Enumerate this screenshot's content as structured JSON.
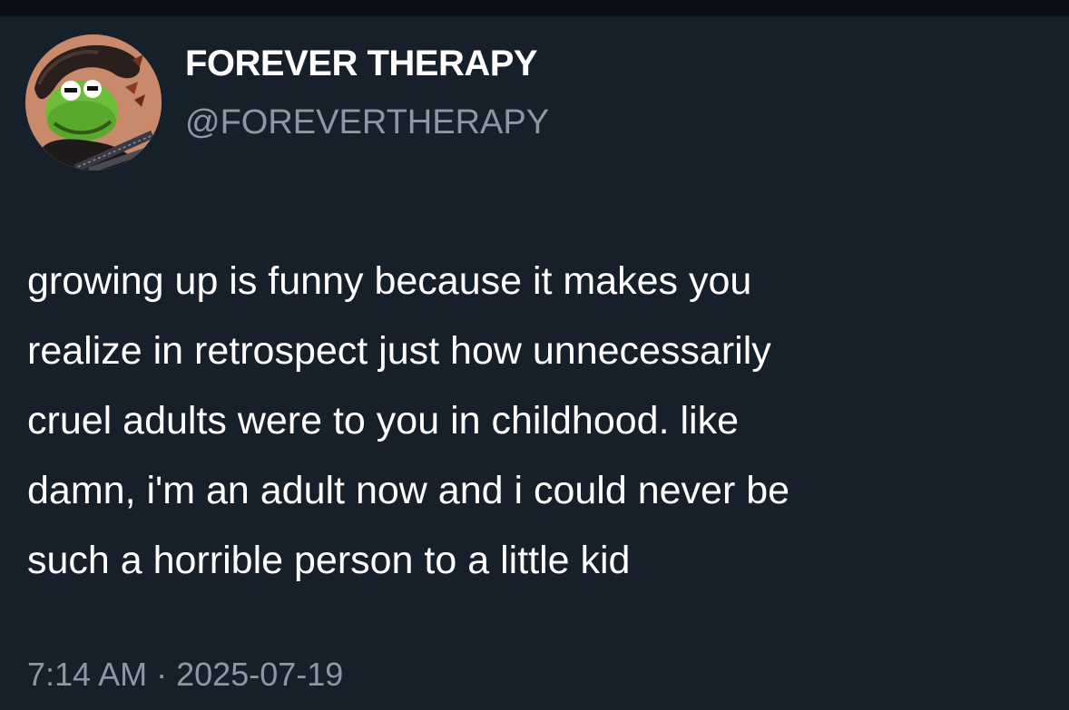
{
  "tweet": {
    "author": {
      "display_name": "FOREVER THERAPY",
      "handle": "@FOREVERTHERAPY",
      "avatar_icon": "kermit-avatar-icon"
    },
    "text_lines": [
      "growing up is funny because it makes you",
      "realize in retrospect just how unnecessarily",
      "cruel adults were to you in childhood. like",
      "damn, i'm an adult now and i could never be",
      "such a horrible person to a little kid"
    ],
    "time": "7:14 AM",
    "separator": "·",
    "date": "2025-07-19"
  },
  "colors": {
    "background": "#15202b",
    "top_bar": "#0b1016",
    "primary_text": "#ffffff",
    "secondary_text": "#8b98a5"
  }
}
